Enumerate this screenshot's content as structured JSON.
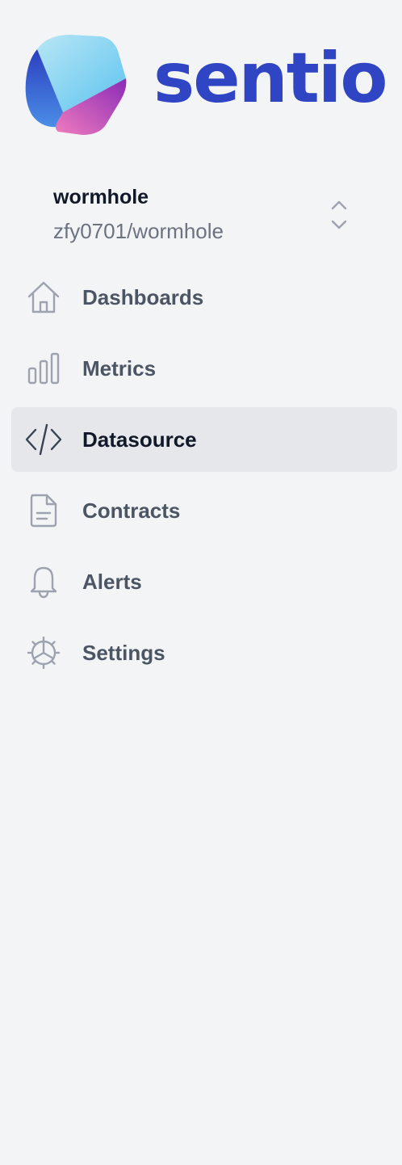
{
  "brand": {
    "name": "sentio",
    "color": "#2f45c4"
  },
  "project": {
    "name": "wormhole",
    "path": "zfy0701/wormhole"
  },
  "nav": {
    "items": [
      {
        "label": "Dashboards",
        "icon": "home-icon",
        "active": false
      },
      {
        "label": "Metrics",
        "icon": "bar-chart-icon",
        "active": false
      },
      {
        "label": "Datasource",
        "icon": "code-icon",
        "active": true
      },
      {
        "label": "Contracts",
        "icon": "document-icon",
        "active": false
      },
      {
        "label": "Alerts",
        "icon": "bell-icon",
        "active": false
      },
      {
        "label": "Settings",
        "icon": "gear-icon",
        "active": false
      }
    ]
  },
  "colors": {
    "background": "#f3f4f6",
    "active_item_bg": "#e5e7eb",
    "text_primary": "#111827",
    "text_secondary": "#4b5563",
    "text_muted": "#6b7280",
    "icon": "#9ca3af"
  }
}
